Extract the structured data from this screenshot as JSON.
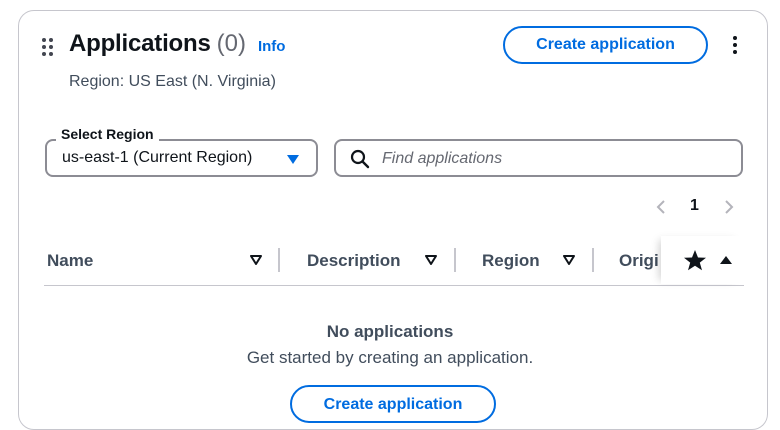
{
  "header": {
    "title": "Applications",
    "count": "(0)",
    "info_label": "Info",
    "region_text": "Region: US East (N. Virginia)",
    "create_button_label": "Create application"
  },
  "filters": {
    "region_select": {
      "label": "Select Region",
      "value": "us-east-1 (Current Region)"
    },
    "search": {
      "placeholder": "Find applications",
      "value": ""
    }
  },
  "pagination": {
    "current_page": "1"
  },
  "table": {
    "columns": [
      "Name",
      "Description",
      "Region",
      "Origi"
    ]
  },
  "empty_state": {
    "title": "No applications",
    "description": "Get started by creating an application.",
    "button_label": "Create application"
  },
  "colors": {
    "accent": "#006ce0",
    "border": "#8c8c94",
    "text": "#0f141a",
    "muted_text": "#414d5c"
  },
  "icons": [
    "drag-handle-icon",
    "more-actions-icon",
    "dropdown-caret-icon",
    "search-icon",
    "chevron-left-icon",
    "chevron-right-icon",
    "filter-sort-icon",
    "star-icon",
    "sort-ascending-icon"
  ]
}
